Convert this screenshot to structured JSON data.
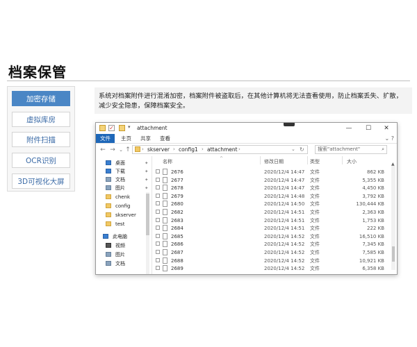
{
  "page": {
    "title": "档案保管",
    "description": "系统对档案附件进行混淆加密，档案附件被盗取后，在其他计算机将无法查看使用，防止档案丢失、扩散，减少安全隐患，保障档案安全。"
  },
  "sidenav": {
    "items": [
      {
        "label": "加密存储",
        "active": true
      },
      {
        "label": "虚拟库房",
        "active": false
      },
      {
        "label": "附件扫描",
        "active": false
      },
      {
        "label": "OCR识别",
        "active": false
      },
      {
        "label": "3D可视化大屏",
        "active": false
      }
    ]
  },
  "explorer": {
    "window_title": "attachment",
    "controls": {
      "minimize": "—",
      "maximize": "☐",
      "close": "✕"
    },
    "ribbon": {
      "file_tab": "文件",
      "tabs": [
        "主页",
        "共享",
        "查看"
      ]
    },
    "address": {
      "segments": [
        "skserver",
        "config1",
        "attachment"
      ]
    },
    "search_placeholder": "搜索\"attachment\"",
    "tree": [
      {
        "label": "桌面",
        "icon": "desktop-icon",
        "pinned": true
      },
      {
        "label": "下载",
        "icon": "download-icon",
        "pinned": true
      },
      {
        "label": "文档",
        "icon": "documents-icon",
        "pinned": true
      },
      {
        "label": "图片",
        "icon": "pictures-icon",
        "pinned": true
      },
      {
        "label": "chenk",
        "icon": "folder-icon",
        "pinned": false
      },
      {
        "label": "config",
        "icon": "folder-icon",
        "pinned": false
      },
      {
        "label": "skserver",
        "icon": "folder-icon",
        "pinned": false
      },
      {
        "label": "test",
        "icon": "folder-icon",
        "pinned": false
      },
      {
        "label": "此电脑",
        "icon": "computer-icon",
        "pinned": false
      },
      {
        "label": "视频",
        "icon": "videos-icon",
        "pinned": false
      },
      {
        "label": "图片",
        "icon": "pictures-icon",
        "pinned": false
      },
      {
        "label": "文档",
        "icon": "documents-icon",
        "pinned": false
      }
    ],
    "columns": {
      "name": "名称",
      "date": "修改日期",
      "type": "类型",
      "size": "大小"
    },
    "files": [
      {
        "name": "2676",
        "date": "2020/12/4 14:47",
        "type": "文件",
        "size": "862 KB"
      },
      {
        "name": "2677",
        "date": "2020/12/4 14:47",
        "type": "文件",
        "size": "5,355 KB"
      },
      {
        "name": "2678",
        "date": "2020/12/4 14:47",
        "type": "文件",
        "size": "4,450 KB"
      },
      {
        "name": "2679",
        "date": "2020/12/4 14:48",
        "type": "文件",
        "size": "3,792 KB"
      },
      {
        "name": "2680",
        "date": "2020/12/4 14:50",
        "type": "文件",
        "size": "130,444 KB"
      },
      {
        "name": "2682",
        "date": "2020/12/4 14:51",
        "type": "文件",
        "size": "2,363 KB"
      },
      {
        "name": "2683",
        "date": "2020/12/4 14:51",
        "type": "文件",
        "size": "1,753 KB"
      },
      {
        "name": "2684",
        "date": "2020/12/4 14:51",
        "type": "文件",
        "size": "222 KB"
      },
      {
        "name": "2685",
        "date": "2020/12/4 14:52",
        "type": "文件",
        "size": "16,510 KB"
      },
      {
        "name": "2686",
        "date": "2020/12/4 14:52",
        "type": "文件",
        "size": "7,345 KB"
      },
      {
        "name": "2687",
        "date": "2020/12/4 14:52",
        "type": "文件",
        "size": "7,585 KB"
      },
      {
        "name": "2688",
        "date": "2020/12/4 14:52",
        "type": "文件",
        "size": "10,921 KB"
      },
      {
        "name": "2689",
        "date": "2020/12/4 14:52",
        "type": "文件",
        "size": "6,358 KB"
      }
    ]
  }
}
